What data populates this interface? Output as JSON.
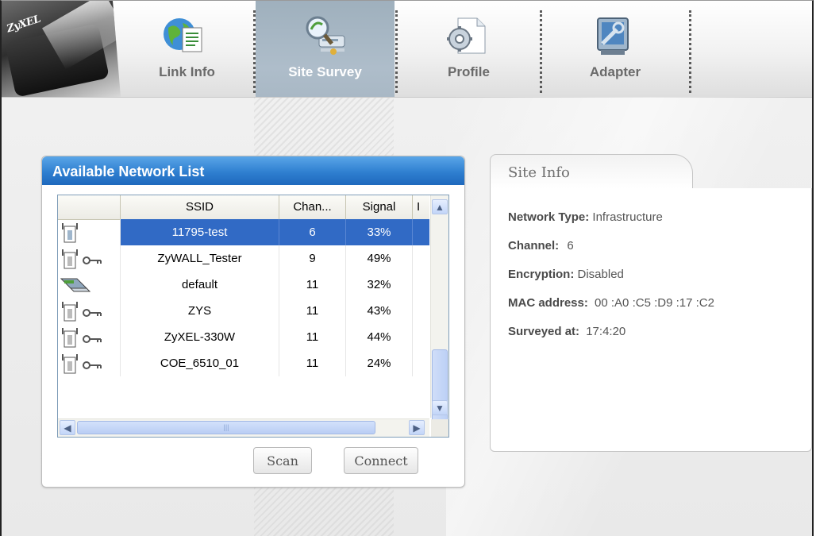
{
  "brand": {
    "logo": "ZyXEL"
  },
  "nav": {
    "tabs": [
      {
        "label": "Link Info",
        "icon": "globe-document-icon",
        "active": false
      },
      {
        "label": "Site Survey",
        "icon": "magnifier-access-point-icon",
        "active": true
      },
      {
        "label": "Profile",
        "icon": "gear-document-icon",
        "active": false
      },
      {
        "label": "Adapter",
        "icon": "adapter-wrench-icon",
        "active": false
      }
    ]
  },
  "network_list": {
    "title": "Available Network List",
    "columns": [
      "",
      "SSID",
      "Chan...",
      "Signal",
      "I"
    ],
    "rows": [
      {
        "icon": "access-point-icon",
        "secured": false,
        "ssid": "11795-test",
        "channel": "6",
        "signal": "33%",
        "selected": true
      },
      {
        "icon": "access-point-icon",
        "secured": true,
        "ssid": "ZyWALL_Tester",
        "channel": "9",
        "signal": "49%",
        "selected": false
      },
      {
        "icon": "adhoc-laptop-icon",
        "secured": false,
        "ssid": "default",
        "channel": "11",
        "signal": "32%",
        "selected": false
      },
      {
        "icon": "access-point-icon",
        "secured": true,
        "ssid": "ZYS",
        "channel": "11",
        "signal": "43%",
        "selected": false
      },
      {
        "icon": "access-point-icon",
        "secured": true,
        "ssid": "ZyXEL-330W",
        "channel": "11",
        "signal": "44%",
        "selected": false
      },
      {
        "icon": "access-point-icon",
        "secured": true,
        "ssid": "COE_6510_01",
        "channel": "11",
        "signal": "24%",
        "selected": false
      }
    ],
    "scan_label": "Scan",
    "connect_label": "Connect"
  },
  "site_info": {
    "title": "Site Info",
    "network_type_label": "Network Type:",
    "network_type": "Infrastructure",
    "channel_label": "Channel:",
    "channel": "6",
    "encryption_label": "Encryption:",
    "encryption": "Disabled",
    "mac_label": "MAC address:",
    "mac": "00 :A0 :C5 :D9 :17 :C2",
    "surveyed_label": "Surveyed at:",
    "surveyed": "17:4:20"
  },
  "colors": {
    "header_blue": "#2f7fd0",
    "selection_blue": "#316ac5",
    "active_tab": "#a9b8c5"
  }
}
